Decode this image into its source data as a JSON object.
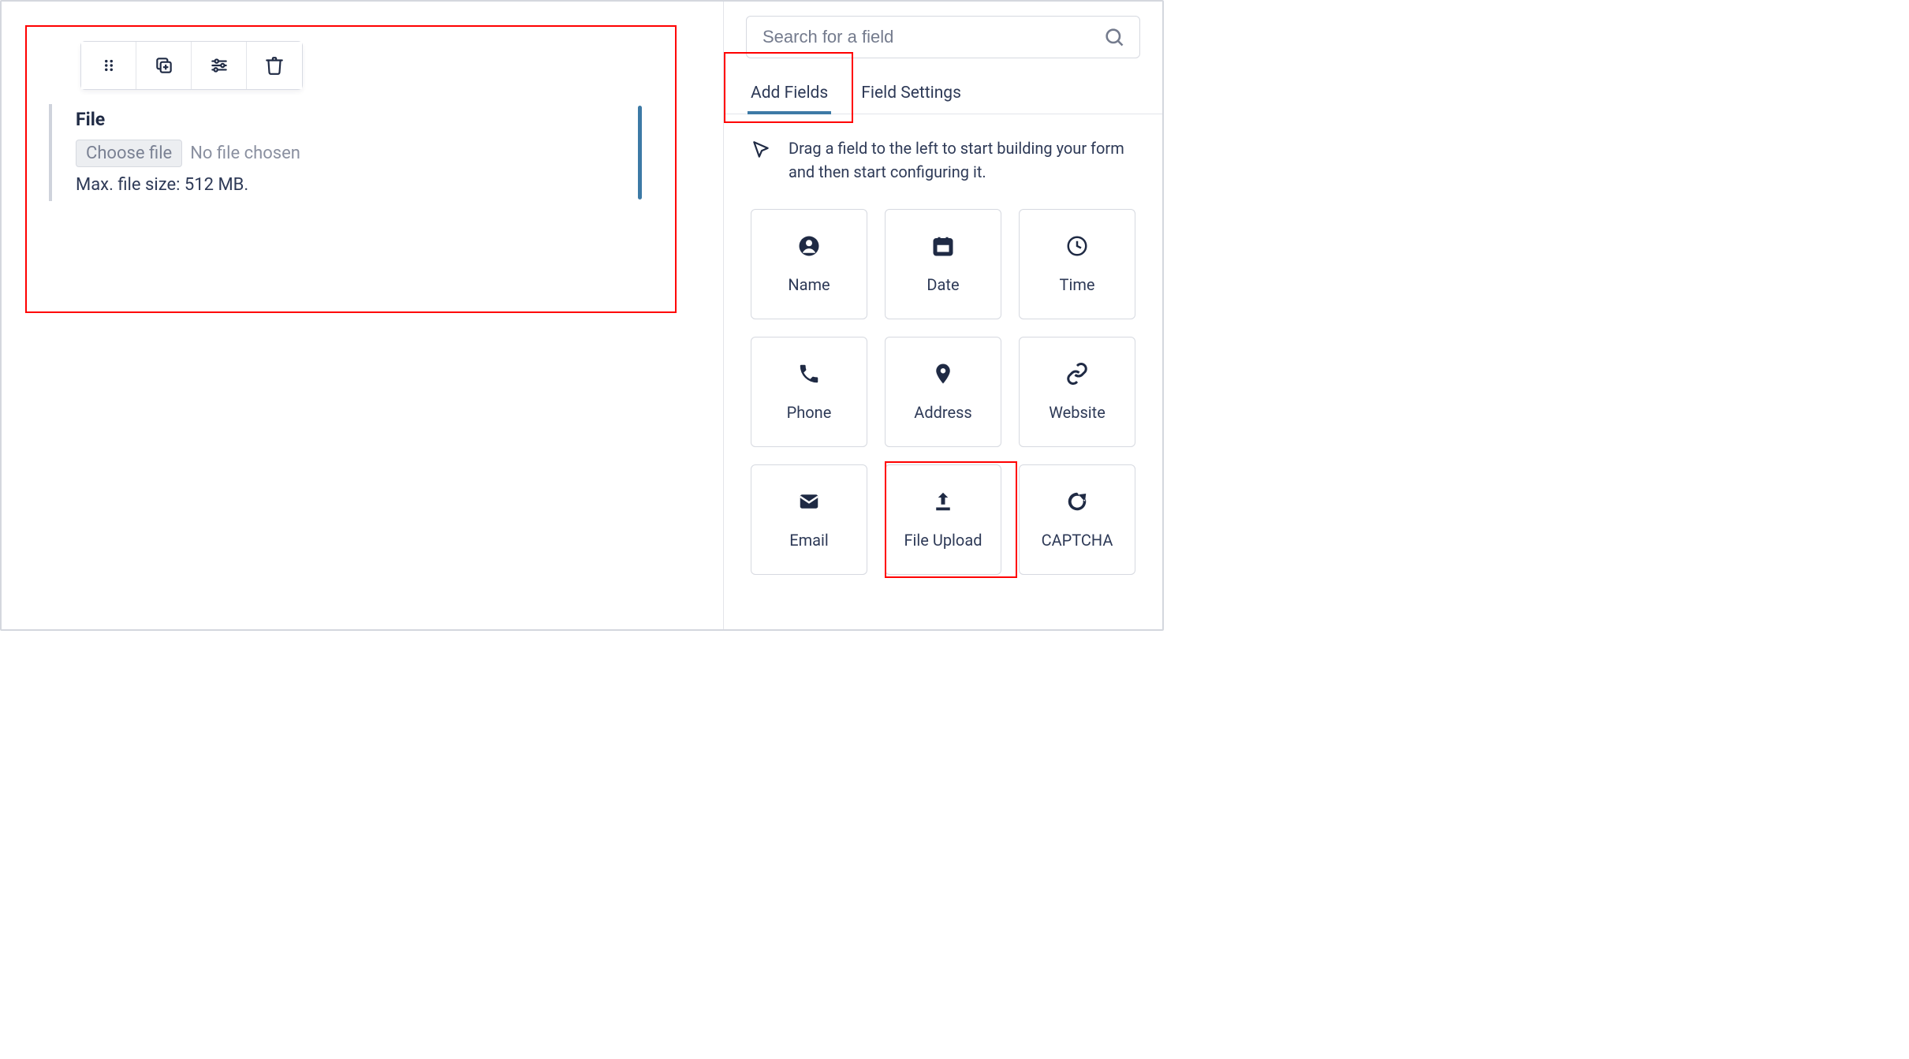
{
  "canvas": {
    "field_label": "File",
    "choose_label": "Choose file",
    "no_file_text": "No file chosen",
    "meta_text": "Max. file size: 512 MB."
  },
  "search": {
    "placeholder": "Search for a field"
  },
  "tabs": {
    "add_fields": "Add Fields",
    "field_settings": "Field Settings"
  },
  "hint": "Drag a field to the left to start building your form and then start configuring it.",
  "tiles": {
    "name": "Name",
    "date": "Date",
    "time": "Time",
    "phone": "Phone",
    "address": "Address",
    "website": "Website",
    "email": "Email",
    "file_upload": "File Upload",
    "captcha": "CAPTCHA"
  }
}
